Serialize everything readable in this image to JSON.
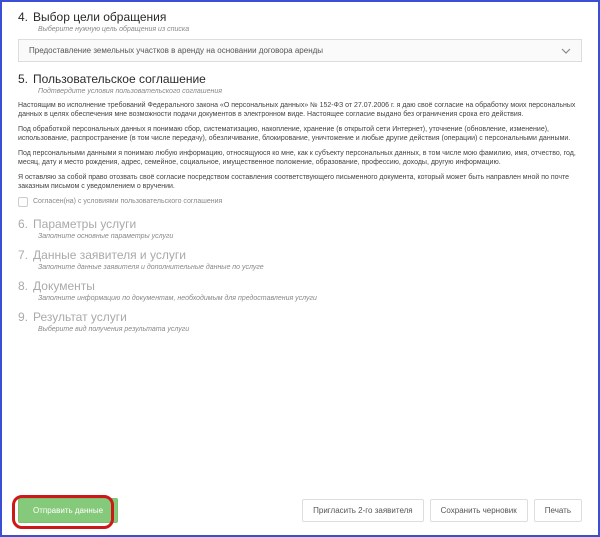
{
  "sections": {
    "s4": {
      "num": "4.",
      "title": "Выбор цели обращения",
      "sub": "Выберите нужную цель обращения из списка",
      "select_value": "Предоставление земельных участков в аренду на основании договора аренды"
    },
    "s5": {
      "num": "5.",
      "title": "Пользовательское соглашение",
      "sub": "Подтвердите условия пользовательского соглашения",
      "p1": "Настоящим во исполнение требований Федерального закона «О персональных данных» № 152-ФЗ от 27.07.2006 г. я даю своё согласие на обработку моих персональных данных в целях обеспечения мне возможности подачи документов в электронном виде. Настоящее согласие выдано без ограничения срока его действия.",
      "p2": "Под обработкой персональных данных я понимаю сбор, систематизацию, накопление, хранение (в открытой сети Интернет), уточнение (обновление, изменение), использование, распространение (в том числе передачу), обезличивание, блокирование, уничтожение и любые другие действия (операции) с персональными данными.",
      "p3": "Под персональными данными я понимаю любую информацию, относящуюся ко мне, как к субъекту персональных данных, в том числе мою фамилию, имя, отчество, год, месяц, дату и место рождения, адрес, семейное, социальное, имущественное положение, образование, профессию, доходы, другую информацию.",
      "p4": "Я оставляю за собой право отозвать своё согласие посредством составления соответствующего письменного документа, который может быть направлен мной по почте заказным письмом с уведомлением о вручении.",
      "checkbox_label": "Согласен(на) с условиями пользовательского соглашения"
    },
    "s6": {
      "num": "6.",
      "title": "Параметры услуги",
      "sub": "Заполните основные параметры услуги"
    },
    "s7": {
      "num": "7.",
      "title": "Данные заявителя и услуги",
      "sub": "Заполните данные заявителя и дополнительные данные по услуге"
    },
    "s8": {
      "num": "8.",
      "title": "Документы",
      "sub": "Заполните информацию по документам, необходимым для предоставления услуги"
    },
    "s9": {
      "num": "9.",
      "title": "Результат услуги",
      "sub": "Выберите вид получения результата услуги"
    }
  },
  "footer": {
    "submit": "Отправить данные",
    "invite": "Пригласить 2-го заявителя",
    "draft": "Сохранить черновик",
    "print": "Печать"
  }
}
